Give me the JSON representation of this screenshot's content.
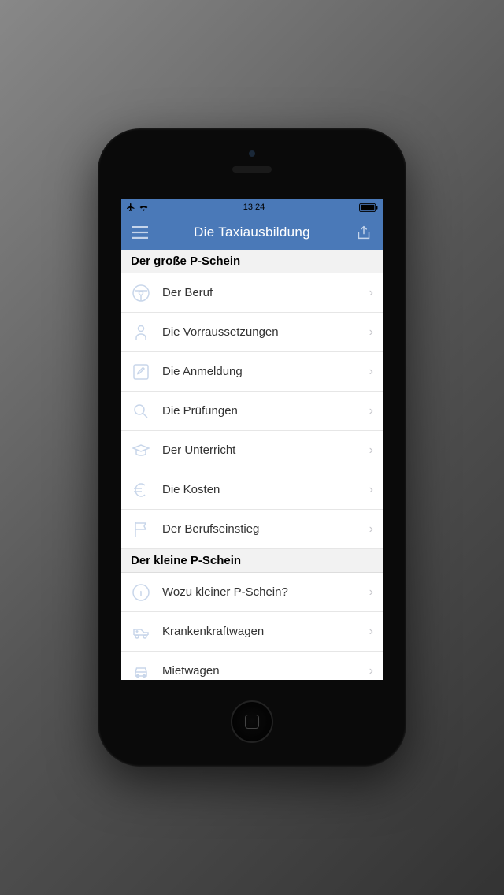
{
  "status_bar": {
    "time": "13:24"
  },
  "navbar": {
    "title": "Die Taxiausbildung"
  },
  "sections": [
    {
      "header": "Der große P-Schein",
      "items": [
        {
          "icon": "steering-wheel-icon",
          "label": "Der Beruf"
        },
        {
          "icon": "person-icon",
          "label": "Die Vorraussetzungen"
        },
        {
          "icon": "edit-icon",
          "label": "Die Anmeldung"
        },
        {
          "icon": "magnifier-icon",
          "label": "Die Prüfungen"
        },
        {
          "icon": "graduation-cap-icon",
          "label": "Der Unterricht"
        },
        {
          "icon": "euro-icon",
          "label": "Die Kosten"
        },
        {
          "icon": "flag-icon",
          "label": "Der Berufseinstieg"
        }
      ]
    },
    {
      "header": "Der kleine P-Schein",
      "items": [
        {
          "icon": "info-icon",
          "label": "Wozu kleiner P-Schein?"
        },
        {
          "icon": "ambulance-icon",
          "label": "Krankenkraftwagen"
        },
        {
          "icon": "car-icon",
          "label": "Mietwagen"
        }
      ]
    }
  ]
}
